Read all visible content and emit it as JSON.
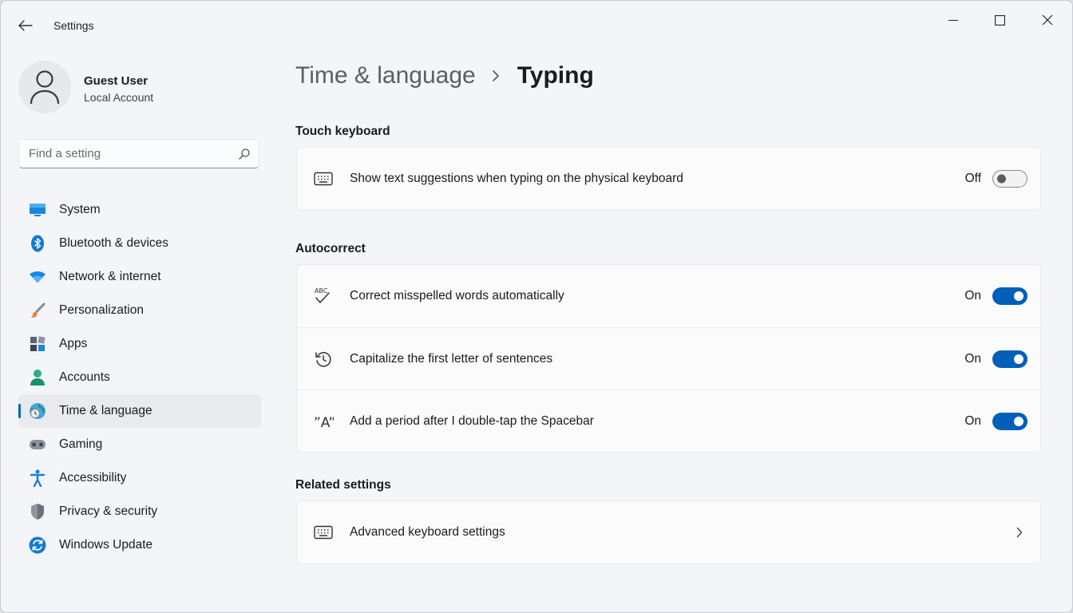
{
  "window": {
    "title": "Settings"
  },
  "profile": {
    "name": "Guest User",
    "account_type": "Local Account"
  },
  "search": {
    "placeholder": "Find a setting"
  },
  "nav": {
    "items": [
      {
        "label": "System",
        "icon": "display-icon"
      },
      {
        "label": "Bluetooth & devices",
        "icon": "bluetooth-icon"
      },
      {
        "label": "Network & internet",
        "icon": "wifi-icon"
      },
      {
        "label": "Personalization",
        "icon": "brush-icon"
      },
      {
        "label": "Apps",
        "icon": "apps-icon"
      },
      {
        "label": "Accounts",
        "icon": "person-icon"
      },
      {
        "label": "Time & language",
        "icon": "globe-clock-icon",
        "active": true
      },
      {
        "label": "Gaming",
        "icon": "gamepad-icon"
      },
      {
        "label": "Accessibility",
        "icon": "accessibility-icon"
      },
      {
        "label": "Privacy & security",
        "icon": "shield-icon"
      },
      {
        "label": "Windows Update",
        "icon": "update-icon"
      }
    ]
  },
  "breadcrumb": {
    "parent": "Time & language",
    "current": "Typing"
  },
  "sections": {
    "touch_keyboard": {
      "title": "Touch keyboard",
      "rows": [
        {
          "label": "Show text suggestions when typing on the physical keyboard",
          "state": "Off",
          "icon": "keyboard-icon"
        }
      ]
    },
    "autocorrect": {
      "title": "Autocorrect",
      "rows": [
        {
          "label": "Correct misspelled words automatically",
          "state": "On",
          "icon": "spellcheck-icon",
          "icon_text": "ABC"
        },
        {
          "label": "Capitalize the first letter of sentences",
          "state": "On",
          "icon": "history-icon"
        },
        {
          "label": "Add a period after I double-tap the Spacebar",
          "state": "On",
          "icon": "quote-a-icon",
          "icon_text": "”A”"
        }
      ]
    },
    "related": {
      "title": "Related settings",
      "rows": [
        {
          "label": "Advanced keyboard settings",
          "icon": "keyboard-icon"
        }
      ]
    }
  },
  "colors": {
    "accent": "#005fb8",
    "active_indicator": "#0067c0",
    "window_bg": "#f3f5f9",
    "card_bg": "#fbfbfc"
  }
}
